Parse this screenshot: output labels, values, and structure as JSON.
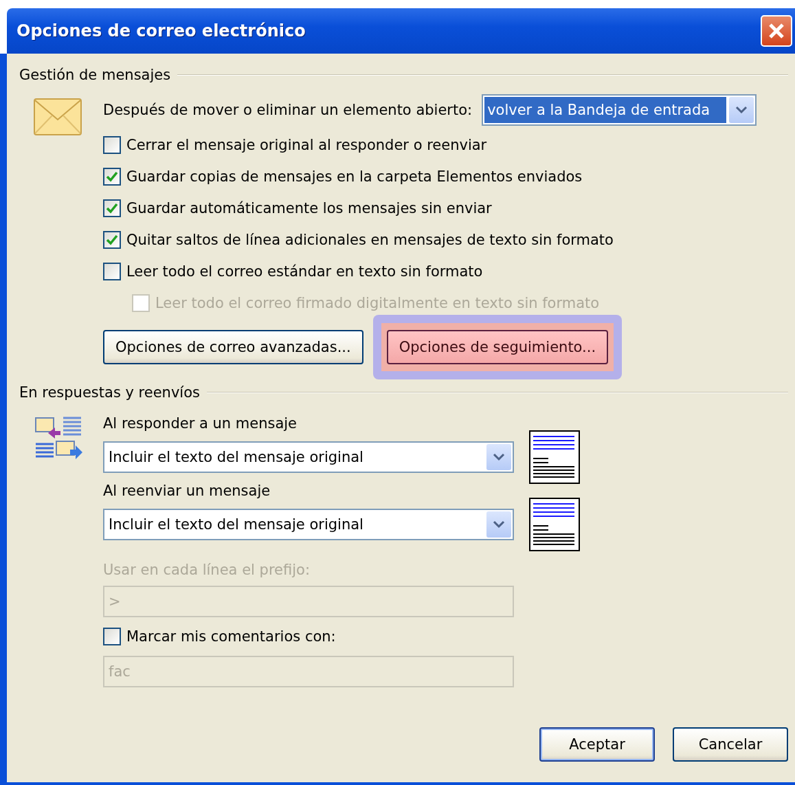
{
  "window": {
    "title": "Opciones de correo electrónico"
  },
  "message_handling": {
    "heading": "Gestión de mensajes",
    "after_move": {
      "label": "Después de mover o eliminar un elemento abierto:",
      "value": "volver a la Bandeja de entrada",
      "focused": true
    },
    "options": [
      {
        "label": "Cerrar el mensaje original al responder o reenviar",
        "checked": false,
        "disabled": false
      },
      {
        "label": "Guardar copias de mensajes en la carpeta Elementos enviados",
        "checked": true,
        "disabled": false
      },
      {
        "label": "Guardar automáticamente los mensajes sin enviar",
        "checked": true,
        "disabled": false
      },
      {
        "label": "Quitar saltos de línea adicionales en mensajes de texto sin formato",
        "checked": true,
        "disabled": false
      },
      {
        "label": "Leer todo el correo estándar en texto sin formato",
        "checked": false,
        "disabled": false,
        "children": [
          {
            "label": "Leer todo el correo firmado digitalmente en texto sin formato",
            "checked": false,
            "disabled": true
          }
        ]
      }
    ],
    "buttons": [
      {
        "label": "Opciones de correo avanzadas...",
        "highlighted": false
      },
      {
        "label": "Opciones de seguimiento...",
        "highlighted": true
      }
    ]
  },
  "replies": {
    "heading": "En respuestas y reenvíos",
    "reply": {
      "label": "Al responder a un mensaje",
      "value": "Incluir el texto del mensaje original"
    },
    "forward": {
      "label": "Al reenviar un mensaje",
      "value": "Incluir el texto del mensaje original"
    },
    "prefix": {
      "label": "Usar en cada línea el prefijo:",
      "value": ">",
      "disabled": true
    },
    "mark_comments": {
      "label": "Marcar mis comentarios con:",
      "checked": false,
      "value": "fac",
      "disabled": true
    }
  },
  "footer_buttons": [
    {
      "label": "Aceptar",
      "default": true
    },
    {
      "label": "Cancelar",
      "default": false
    }
  ]
}
